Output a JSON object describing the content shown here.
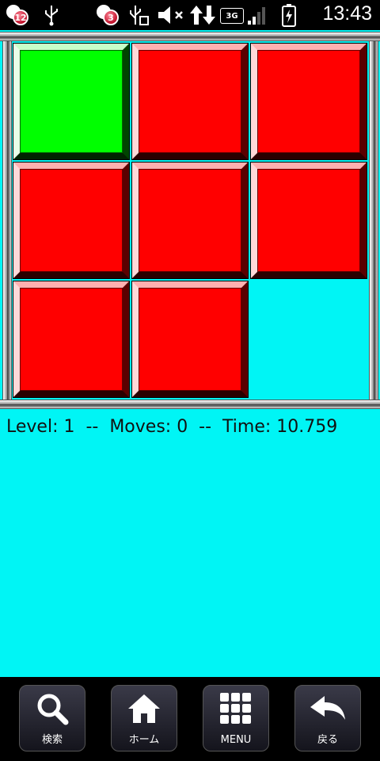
{
  "status_bar": {
    "notification_badges": [
      "12",
      "3"
    ],
    "network": "3G",
    "time": "13:43"
  },
  "game": {
    "grid": [
      [
        "green",
        "red",
        "red"
      ],
      [
        "red",
        "red",
        "red"
      ],
      [
        "red",
        "red",
        "empty"
      ]
    ],
    "colors": {
      "red": "#ff0000",
      "green": "#00ff00",
      "background": "#00f5f5"
    },
    "info_text": "Level: 1  --  Moves: 0  --  Time: 10.759"
  },
  "nav": {
    "search_label": "検索",
    "home_label": "ホーム",
    "menu_label": "MENU",
    "back_label": "戻る"
  }
}
